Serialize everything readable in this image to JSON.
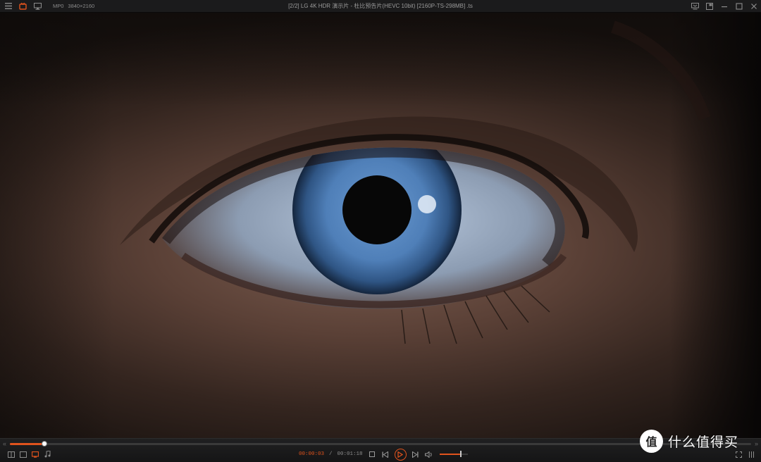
{
  "window": {
    "title": "[2/2] LG 4K HDR 演示片 - 杜比预告片(HEVC 10bit) [2160P-TS-298MB] .ts",
    "format_badge": "MP0",
    "resolution": "3840×2160"
  },
  "icons": {
    "menu": "menu-icon",
    "logo": "player-logo-icon",
    "monitor": "monitor-icon",
    "pin": "pin-icon",
    "mini_mode": "mini-mode-icon",
    "minimize": "minimize-icon",
    "maximize": "maximize-icon",
    "close": "close-icon"
  },
  "playback": {
    "current_time": "00:00:03",
    "separator": "/",
    "duration": "00:01:18",
    "progress_fraction": 0.047,
    "volume_fraction": 0.75
  },
  "colors": {
    "accent": "#e0531d",
    "titlebar_bg": "#1b1b1c",
    "control_bg": "#1a1a1b",
    "iris": "#4f7fb8"
  },
  "watermark": {
    "logo_glyph": "值",
    "text": "什么值得买"
  }
}
